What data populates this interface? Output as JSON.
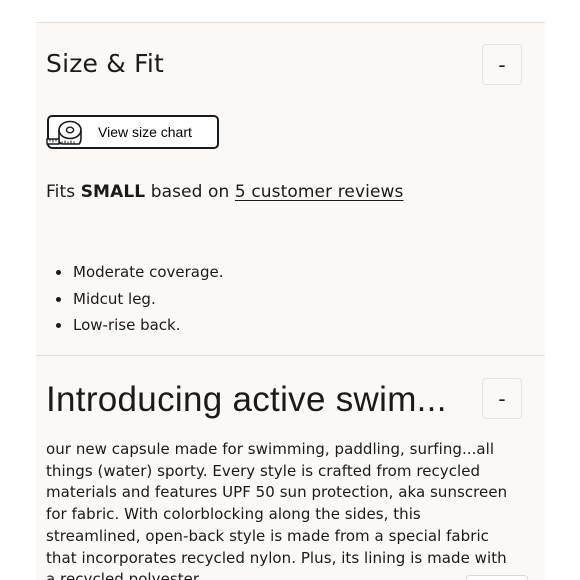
{
  "size_fit": {
    "title": "Size & Fit",
    "toggle_label": "-",
    "size_chart_button": "View size chart",
    "fits_prefix": "Fits",
    "fits_size": "SMALL",
    "fits_middle": "based on",
    "reviews_link": "5 customer reviews",
    "features": [
      "Moderate coverage.",
      "Midcut leg.",
      "Low-rise back."
    ]
  },
  "intro": {
    "title": "Introducing active swim...",
    "toggle_label": "-",
    "body": "our new capsule made for swimming, paddling, surfing...all things (water) sporty. Every style is crafted from recycled materials and features UPF 50 sun protection, aka sunscreen for fabric. With colorblocking along the sides, this streamlined, open-back style is made from a special fabric that incorporates recycled nylon. Plus, its lining is made with a recycled polyester."
  },
  "icons": {
    "size_chart": "measuring-tape-icon"
  }
}
